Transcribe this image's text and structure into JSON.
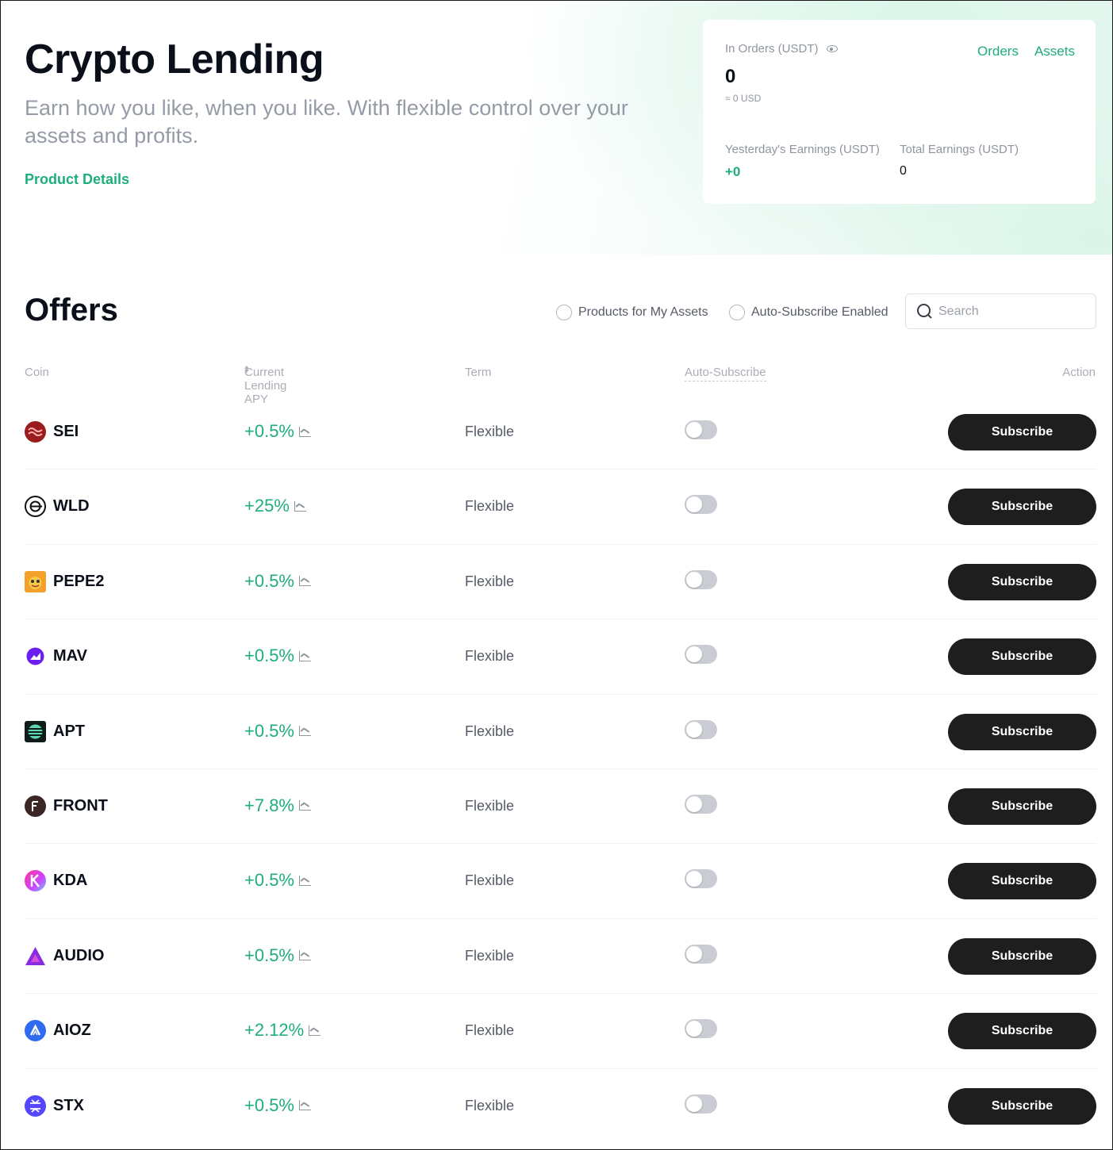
{
  "hero": {
    "title": "Crypto Lending",
    "subtitle": "Earn how you like, when you like. With flexible control over your assets and profits.",
    "link": "Product Details"
  },
  "summary": {
    "in_orders_label": "In Orders (USDT)",
    "in_orders_value": "0",
    "in_orders_usd": "≈ 0 USD",
    "tabs": [
      "Orders",
      "Assets"
    ],
    "yesterday_label": "Yesterday's Earnings (USDT)",
    "yesterday_value": "+0",
    "total_label": "Total Earnings (USDT)",
    "total_value": "0"
  },
  "offers": {
    "title": "Offers",
    "filter_assets": "Products for My Assets",
    "filter_auto": "Auto-Subscribe Enabled",
    "search_placeholder": "Search"
  },
  "table": {
    "headers": {
      "coin": "Coin",
      "apy": "Current Lending APY",
      "term": "Term",
      "auto": "Auto-Subscribe",
      "action": "Action"
    },
    "rows": [
      {
        "coin": "SEI",
        "apy": "+0.5%",
        "term": "Flexible",
        "action": "Subscribe",
        "logo": "sei-logo",
        "color": "#9b1c1c"
      },
      {
        "coin": "WLD",
        "apy": "+25%",
        "term": "Flexible",
        "action": "Subscribe",
        "logo": "wld-logo",
        "color": "#111111"
      },
      {
        "coin": "PEPE2",
        "apy": "+0.5%",
        "term": "Flexible",
        "action": "Subscribe",
        "logo": "pepe2-logo",
        "color": "#f2a12a"
      },
      {
        "coin": "MAV",
        "apy": "+0.5%",
        "term": "Flexible",
        "action": "Subscribe",
        "logo": "mav-logo",
        "color": "#6a1ff0"
      },
      {
        "coin": "APT",
        "apy": "+0.5%",
        "term": "Flexible",
        "action": "Subscribe",
        "logo": "apt-logo",
        "color": "#0f1d1a"
      },
      {
        "coin": "FRONT",
        "apy": "+7.8%",
        "term": "Flexible",
        "action": "Subscribe",
        "logo": "front-logo",
        "color": "#3b2525"
      },
      {
        "coin": "KDA",
        "apy": "+0.5%",
        "term": "Flexible",
        "action": "Subscribe",
        "logo": "kda-logo",
        "color": "#e052c8"
      },
      {
        "coin": "AUDIO",
        "apy": "+0.5%",
        "term": "Flexible",
        "action": "Subscribe",
        "logo": "audio-logo",
        "color": "#8a2be2"
      },
      {
        "coin": "AIOZ",
        "apy": "+2.12%",
        "term": "Flexible",
        "action": "Subscribe",
        "logo": "aioz-logo",
        "color": "#2f6bf0"
      },
      {
        "coin": "STX",
        "apy": "+0.5%",
        "term": "Flexible",
        "action": "Subscribe",
        "logo": "stx-logo",
        "color": "#5546ff"
      }
    ]
  },
  "colors": {
    "accent": "#1eae7a",
    "button": "#1e1e1e"
  }
}
